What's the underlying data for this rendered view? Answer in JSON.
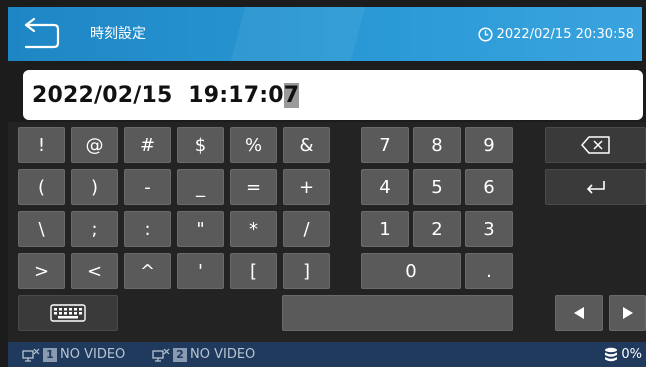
{
  "header": {
    "title": "時刻設定",
    "datetime": "2022/02/15 20:30:58",
    "back_icon": "back-arrow-icon",
    "clock_icon": "clock-icon"
  },
  "input": {
    "value_main": "2022/02/15  19:17:0",
    "value_cursor": "7"
  },
  "keyboard": {
    "symbols": [
      [
        "!",
        "@",
        "#",
        "$",
        "%",
        "&"
      ],
      [
        "(",
        ")",
        "-",
        "_",
        "=",
        "+"
      ],
      [
        "\\",
        ";",
        ":",
        "\"",
        "*",
        "/"
      ],
      [
        ">",
        "<",
        "^",
        "'",
        "[",
        "]"
      ]
    ],
    "numbers": [
      [
        "7",
        "8",
        "9"
      ],
      [
        "4",
        "5",
        "6"
      ],
      [
        "1",
        "2",
        "3"
      ]
    ],
    "zero": "0",
    "dot": ".",
    "backspace_icon": "backspace-icon",
    "enter_icon": "enter-icon",
    "keyboard_icon": "keyboard-icon",
    "left_icon": "left-arrow-icon",
    "right_icon": "right-arrow-icon"
  },
  "statusbar": {
    "ch1_num": "1",
    "ch1_text": "NO VIDEO",
    "ch2_num": "2",
    "ch2_text": "NO VIDEO",
    "storage": "0%",
    "network_icon": "network-icon",
    "storage_icon": "database-icon"
  },
  "colors": {
    "header": "#2a9ad6",
    "key": "#5a5a5a",
    "status": "#1f3a5c"
  }
}
